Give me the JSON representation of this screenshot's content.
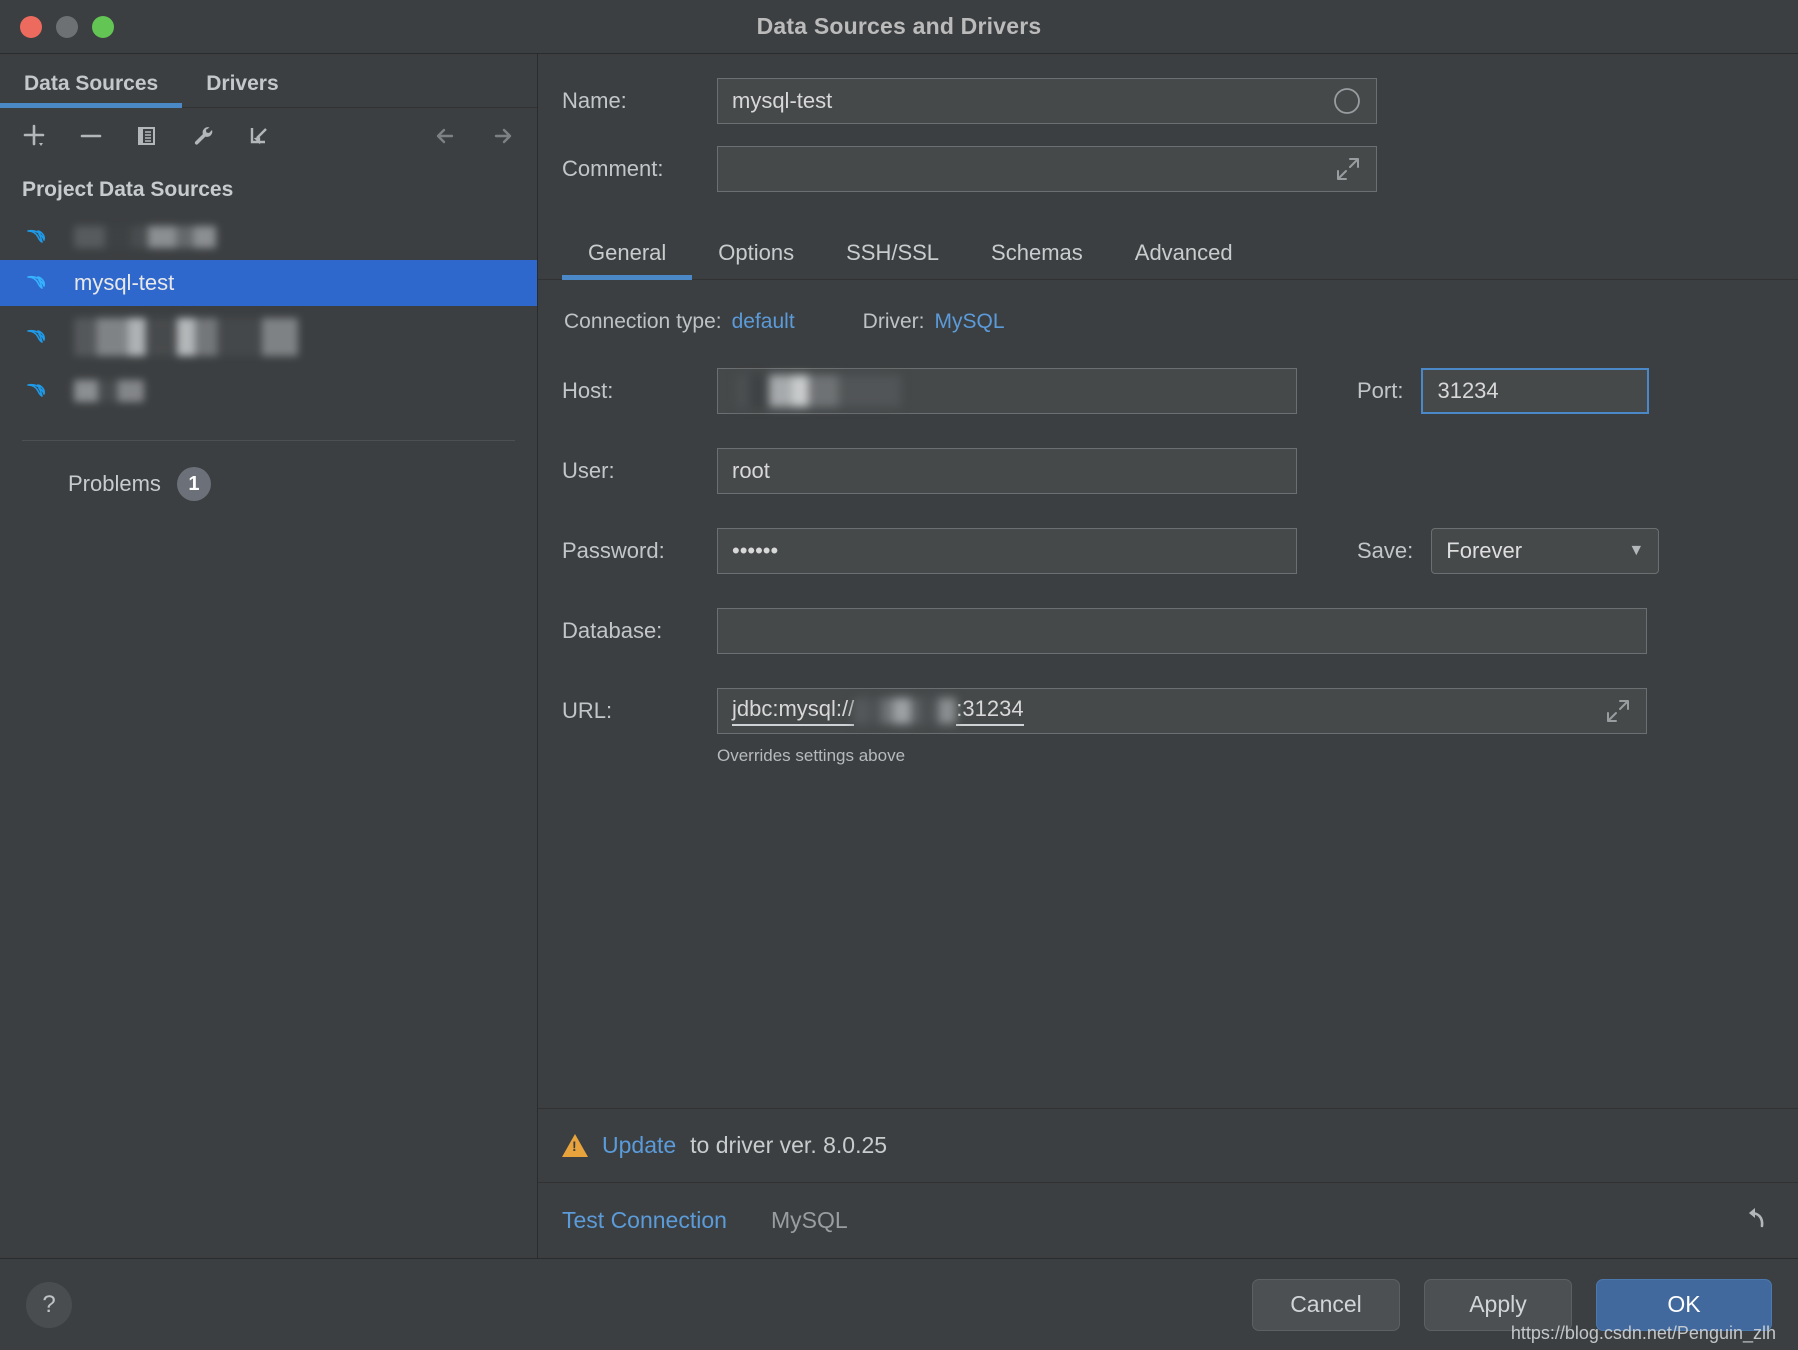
{
  "window": {
    "title": "Data Sources and Drivers",
    "traffic_lights": [
      "close",
      "minimize",
      "zoom"
    ]
  },
  "sidebar": {
    "tabs": [
      {
        "label": "Data Sources",
        "active": true
      },
      {
        "label": "Drivers",
        "active": false
      }
    ],
    "toolbar": [
      {
        "name": "add-icon",
        "glyph": "+"
      },
      {
        "name": "remove-icon",
        "glyph": "−"
      },
      {
        "name": "copy-icon",
        "glyph": "❐"
      },
      {
        "name": "wrench-icon",
        "glyph": "ὒ7"
      },
      {
        "name": "import-icon",
        "glyph": "↲"
      },
      {
        "name": "back-arrow-icon",
        "glyph": "←"
      },
      {
        "name": "forward-arrow-icon",
        "glyph": "→"
      }
    ],
    "group_header": "Project Data Sources",
    "items": [
      {
        "label": "",
        "redacted": true,
        "selected": false
      },
      {
        "label": "mysql-test",
        "redacted": false,
        "selected": true
      },
      {
        "label": "",
        "redacted": true,
        "selected": false
      },
      {
        "label": "",
        "redacted": true,
        "selected": false
      }
    ],
    "problems": {
      "label": "Problems",
      "count": "1"
    }
  },
  "form": {
    "name": {
      "label": "Name:",
      "value": "mysql-test",
      "icon": "color-circle-icon"
    },
    "comment": {
      "label": "Comment:",
      "value": "",
      "placeholder": "",
      "icon": "expand-icon"
    }
  },
  "tabs": [
    {
      "label": "General",
      "active": true
    },
    {
      "label": "Options",
      "active": false
    },
    {
      "label": "SSH/SSL",
      "active": false
    },
    {
      "label": "Schemas",
      "active": false
    },
    {
      "label": "Advanced",
      "active": false
    }
  ],
  "general": {
    "connection_type_label": "Connection type:",
    "connection_type_value": "default",
    "driver_label": "Driver:",
    "driver_value": "MySQL",
    "host": {
      "label": "Host:",
      "value": "",
      "redacted": true
    },
    "port": {
      "label": "Port:",
      "value": "31234",
      "focused": true
    },
    "user": {
      "label": "User:",
      "value": "root"
    },
    "password": {
      "label": "Password:",
      "value": "••••••"
    },
    "save": {
      "label": "Save:",
      "value": "Forever"
    },
    "database": {
      "label": "Database:",
      "value": ""
    },
    "url": {
      "label": "URL:",
      "prefix": "jdbc:mysql://",
      "suffix": ":31234",
      "hint": "Overrides settings above",
      "icon": "expand-icon"
    }
  },
  "warning": {
    "icon": "warning-triangle-icon",
    "link": "Update",
    "text": "to driver ver. 8.0.25"
  },
  "status_bar": {
    "test_connection": "Test Connection",
    "driver_name": "MySQL",
    "revert_icon": "revert-arrow-icon"
  },
  "footer": {
    "help": "?",
    "cancel": "Cancel",
    "apply": "Apply",
    "ok": "OK"
  },
  "watermark": "https://blog.csdn.net/Penguin_zlh",
  "colors": {
    "accent_blue": "#4a88c7",
    "selection_blue": "#2f68cd",
    "link_blue": "#5b9bd9",
    "primary_button": "#41699d",
    "warning_orange": "#e8a33d",
    "panel_bg": "#3c3f41",
    "input_bg": "#45494a"
  }
}
